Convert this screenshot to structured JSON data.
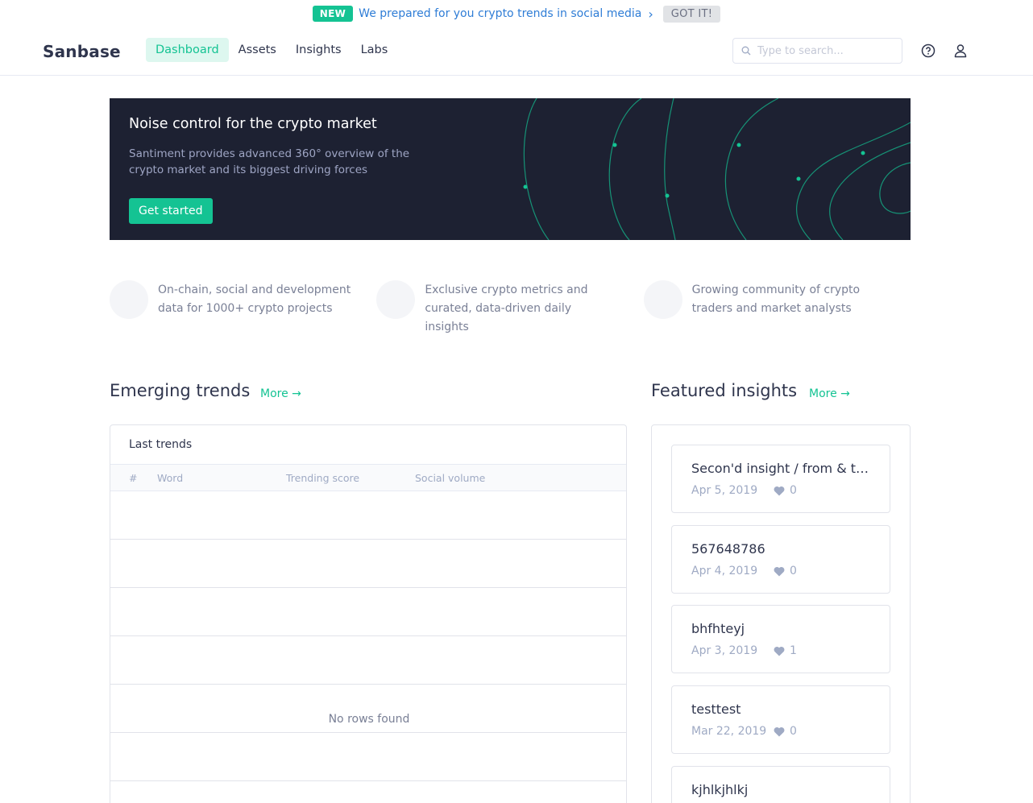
{
  "announcement": {
    "badge": "NEW",
    "text": "We prepared for you crypto trends in social media",
    "dismiss_label": "GOT IT!"
  },
  "header": {
    "logo": "Sanbase",
    "nav": [
      {
        "label": "Dashboard",
        "active": true
      },
      {
        "label": "Assets",
        "active": false
      },
      {
        "label": "Insights",
        "active": false
      },
      {
        "label": "Labs",
        "active": false
      }
    ],
    "search": {
      "placeholder": "Type to search...",
      "value": ""
    },
    "icons": [
      "help-icon",
      "user-icon"
    ]
  },
  "hero": {
    "title": "Noise control for the crypto market",
    "description": "Santiment provides advanced 360° overview of the crypto market and its biggest driving forces",
    "cta_label": "Get started"
  },
  "features": [
    {
      "text": "On-chain, social and development data for 1000+ crypto projects"
    },
    {
      "text": "Exclusive crypto metrics and curated, data-driven daily insights"
    },
    {
      "text": "Growing community of crypto traders and market analysts"
    }
  ],
  "trends": {
    "title": "Emerging trends",
    "more_label": "More →",
    "caption": "Last trends",
    "columns": [
      "#",
      "Word",
      "Trending score",
      "Social volume"
    ],
    "rows": [],
    "empty_text": "No rows found"
  },
  "insights": {
    "title": "Featured insights",
    "more_label": "More →",
    "items": [
      {
        "title": "Secon'd insight / from & tre...",
        "date": "Apr 5, 2019",
        "likes": "0"
      },
      {
        "title": "567648786",
        "date": "Apr 4, 2019",
        "likes": "0"
      },
      {
        "title": "bhfhteyj",
        "date": "Apr 3, 2019",
        "likes": "1"
      },
      {
        "title": "testtest",
        "date": "Mar 22, 2019",
        "likes": "0"
      },
      {
        "title": "kjhlkjhlkj",
        "date": "",
        "likes": ""
      }
    ]
  },
  "colors": {
    "accent": "#14c393",
    "hero_bg": "#1d2132",
    "link": "#2f7dd6"
  }
}
